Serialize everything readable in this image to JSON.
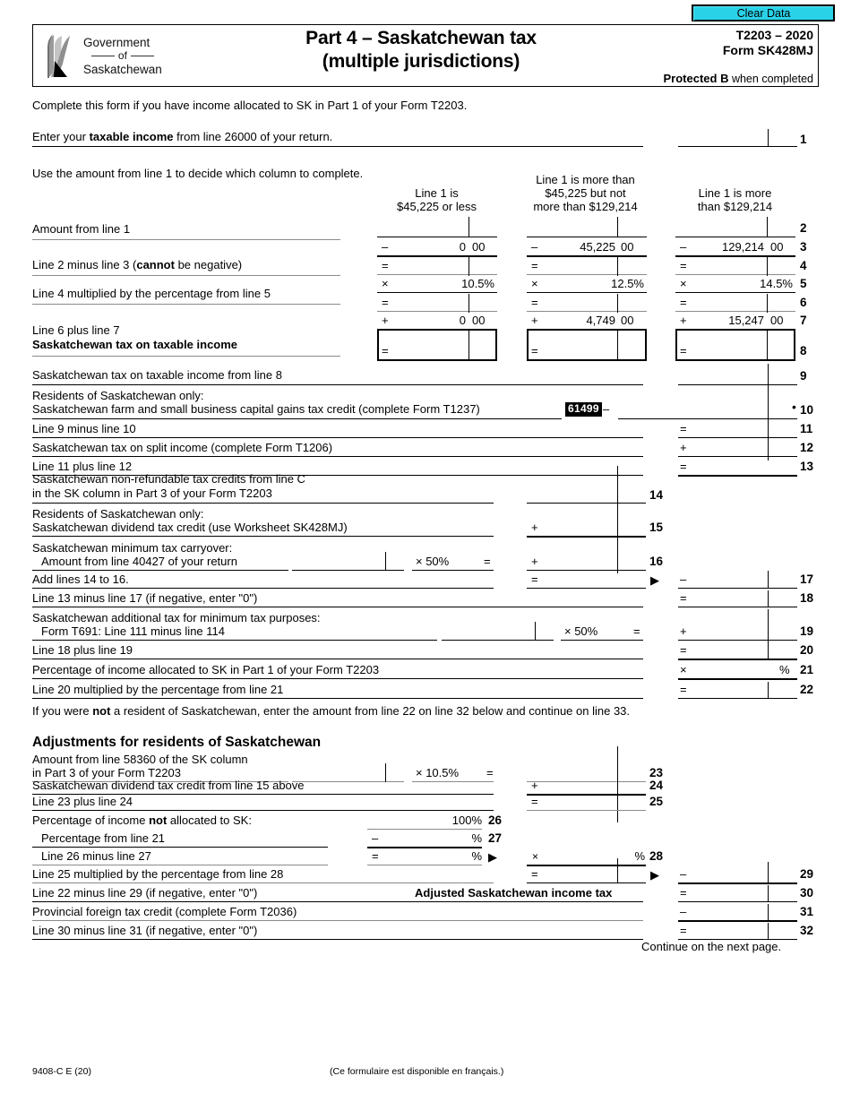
{
  "toolbar": {
    "clear_data_label": "Clear Data"
  },
  "header": {
    "logo": {
      "line1": "Government",
      "line2": "of",
      "line3": "Saskatchewan"
    },
    "title_line1": "Part 4 – Saskatchewan tax",
    "title_line2": "(multiple jurisdictions)",
    "form_year": "T2203 – 2020",
    "form_code": "Form SK428MJ",
    "protected_bold": "Protected B",
    "protected_rest": " when completed"
  },
  "intro": {
    "complete_note": "Complete this form if you have income allocated to SK in Part 1 of your Form T2203.",
    "line1_pre": "Enter your ",
    "line1_bold": "taxable income",
    "line1_post": " from line 26000 of your return.",
    "line1_num": "1",
    "use_amount_note": "Use the amount from line 1 to decide which column to complete."
  },
  "columns": {
    "col1": {
      "head1": "Line 1 is",
      "head2": "$45,225 or less"
    },
    "col2": {
      "head1": "Line 1 is more than",
      "head2": "$45,225 but not",
      "head3": "more than $129,214"
    },
    "col3": {
      "head1": "Line 1 is more",
      "head2": "than $129,214"
    }
  },
  "bracket_rows": [
    {
      "num": "2",
      "label": "Amount from line 1",
      "ops": [
        "",
        "",
        ""
      ],
      "values": [
        "",
        "",
        ""
      ],
      "cents": [
        "",
        "",
        ""
      ]
    },
    {
      "num": "3",
      "label": "",
      "ops": [
        "–",
        "–",
        "–"
      ],
      "values": [
        "0",
        "45,225",
        "129,214"
      ],
      "cents": [
        "00",
        "00",
        "00"
      ]
    },
    {
      "num": "4",
      "label_pre": "Line 2 minus line 3 (",
      "label_bold": "cannot",
      "label_post": " be negative)",
      "ops": [
        "=",
        "=",
        "="
      ],
      "values": [
        "",
        "",
        ""
      ],
      "cents": [
        "",
        "",
        ""
      ]
    },
    {
      "num": "5",
      "label": "",
      "ops": [
        "×",
        "×",
        "×"
      ],
      "values": [
        "10.5%",
        "12.5%",
        "14.5%"
      ],
      "cents": [
        "",
        "",
        ""
      ]
    },
    {
      "num": "6",
      "label": "Line 4 multiplied by the percentage from line 5",
      "ops": [
        "=",
        "=",
        "="
      ],
      "values": [
        "",
        "",
        ""
      ],
      "cents": [
        "",
        "",
        ""
      ]
    },
    {
      "num": "7",
      "label": "",
      "ops": [
        "+",
        "+",
        "+"
      ],
      "values": [
        "0",
        "4,749",
        "15,247"
      ],
      "cents": [
        "00",
        "00",
        "00"
      ]
    },
    {
      "num": "8",
      "label_l1": "Line 6 plus line 7",
      "label_l2": "Saskatchewan tax on taxable income",
      "ops": [
        "=",
        "=",
        "="
      ],
      "values": [
        "",
        "",
        ""
      ],
      "cents": [
        "",
        "",
        ""
      ]
    }
  ],
  "lines": {
    "l9": {
      "num": "9",
      "label": "Saskatchewan tax on taxable income from line 8"
    },
    "l10": {
      "num": "10",
      "label_l1": "Residents of Saskatchewan only:",
      "label_l2": "Saskatchewan farm and small business capital gains tax credit (complete Form T1237)",
      "code": "61499",
      "op": "–",
      "bullet": "•"
    },
    "l11": {
      "num": "11",
      "label": "Line 9 minus line 10",
      "op": "="
    },
    "l12": {
      "num": "12",
      "label": "Saskatchewan tax on split income (complete Form T1206)",
      "op": "+"
    },
    "l13": {
      "num": "13",
      "label": "Line 11 plus line 12",
      "op": "="
    },
    "l14": {
      "num": "14",
      "label_l1": "Saskatchewan non-refundable tax credits from line C",
      "label_l2": "in the SK column in Part 3 of your Form T2203",
      "op": ""
    },
    "l15": {
      "num": "15",
      "label_l1": "Residents of Saskatchewan only:",
      "label_l2": "Saskatchewan dividend tax credit (use Worksheet SK428MJ)",
      "op": "+"
    },
    "l16": {
      "num": "16",
      "label_l1": "Saskatchewan minimum tax carryover:",
      "label_l2": "Amount from line 40427 of your return",
      "mult": "×  50%",
      "eq": "=",
      "op": "+"
    },
    "l17": {
      "num": "17",
      "label": "Add lines 14 to 16.",
      "op_mid": "=",
      "arrow": "▶",
      "op": "–"
    },
    "l18": {
      "num": "18",
      "label": "Line 13 minus line 17 (if negative, enter \"0\")",
      "op": "="
    },
    "l19": {
      "num": "19",
      "label_l1": "Saskatchewan additional tax for minimum tax purposes:",
      "label_l2": "Form T691: Line 111 minus line 114",
      "mult": "×  50%",
      "eq": "=",
      "op": "+"
    },
    "l20": {
      "num": "20",
      "label": "Line 18 plus line 19",
      "op": "="
    },
    "l21": {
      "num": "21",
      "label": "Percentage of income allocated to SK in Part 1 of your Form T2203",
      "op": "×",
      "pct": "%"
    },
    "l22": {
      "num": "22",
      "label": "Line 20 multiplied by the percentage from line 21",
      "op": "="
    },
    "not_resident_pre": "If you were ",
    "not_resident_bold": "not",
    "not_resident_post": " a resident of Saskatchewan, enter the amount from line 22 on line 32 below and continue on line 33."
  },
  "adjustments": {
    "heading": "Adjustments for residents of Saskatchewan",
    "l23": {
      "num": "23",
      "label_l1": "Amount from line 58360 of the SK column",
      "label_l2": "in Part 3 of your Form T2203",
      "mult": "×  10.5%",
      "eq": "="
    },
    "l24": {
      "num": "24",
      "label": "Saskatchewan dividend tax credit from line 15 above",
      "op": "+"
    },
    "l25": {
      "num": "25",
      "label": "Line 23 plus line 24",
      "op": "="
    },
    "l26": {
      "num": "26",
      "label_pre": "Percentage of income ",
      "label_bold": "not",
      "label_post": " allocated to SK:",
      "value": "100%"
    },
    "l27": {
      "num": "27",
      "label": "Percentage from line 21",
      "op": "–",
      "pct": "%"
    },
    "l28": {
      "num": "28",
      "label": "Line 26 minus line 27",
      "op": "=",
      "pct": "%",
      "arrow": "▶",
      "op2": "×",
      "pct2": "%"
    },
    "l29": {
      "num": "29",
      "label": "Line 25 multiplied by the percentage from line 28",
      "op_mid": "=",
      "arrow": "▶",
      "op": "–"
    },
    "l30": {
      "num": "30",
      "label": "Line 22 minus line 29 (if negative, enter \"0\")",
      "center_bold": "Adjusted Saskatchewan income tax",
      "op": "="
    },
    "l31": {
      "num": "31",
      "label": "Provincial foreign tax credit (complete Form T2036)",
      "op": "–"
    },
    "l32": {
      "num": "32",
      "label": "Line 30 minus line 31 (if negative, enter \"0\")",
      "op": "="
    }
  },
  "footer": {
    "continue": "Continue on the next page.",
    "form_id": "9408-C E (20)",
    "french_note": "(Ce formulaire est disponible en français.)"
  },
  "colors": {
    "accent_button": "#2ad2e8",
    "badge_bg": "#000000",
    "rule": "#000000",
    "rule_light": "#8a8a8a"
  }
}
